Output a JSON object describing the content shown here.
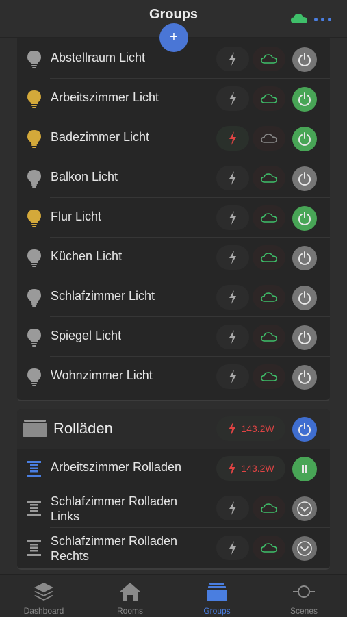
{
  "header": {
    "title": "Groups",
    "add_label": "+"
  },
  "lights": [
    {
      "label": "Abstellraum Licht",
      "on": false,
      "bolt_active": false
    },
    {
      "label": "Arbeitszimmer Licht",
      "on": true,
      "bolt_active": false
    },
    {
      "label": "Badezimmer Licht",
      "on": true,
      "bolt_active": true
    },
    {
      "label": "Balkon Licht",
      "on": false,
      "bolt_active": false
    },
    {
      "label": "Flur Licht",
      "on": true,
      "bolt_active": false
    },
    {
      "label": "Küchen Licht",
      "on": false,
      "bolt_active": false
    },
    {
      "label": "Schlafzimmer Licht",
      "on": false,
      "bolt_active": false
    },
    {
      "label": "Spiegel Licht",
      "on": false,
      "bolt_active": false
    },
    {
      "label": "Wohnzimmer Licht",
      "on": false,
      "bolt_active": false
    }
  ],
  "blinds_group": {
    "title": "Rolläden",
    "power": "143.2W",
    "items": [
      {
        "label": "Arbeitszimmer Rolladen",
        "power": "143.2W"
      },
      {
        "label": "Schlafzimmer Rolladen Links"
      },
      {
        "label": "Schlafzimmer Rolladen Rechts"
      }
    ]
  },
  "tabs": [
    {
      "label": "Dashboard",
      "icon": "layers-icon"
    },
    {
      "label": "Rooms",
      "icon": "house-icon"
    },
    {
      "label": "Groups",
      "icon": "groups-icon",
      "active": true
    },
    {
      "label": "Scenes",
      "icon": "scenes-icon"
    }
  ],
  "colors": {
    "accent": "#4a7ee0",
    "on_green": "#48a556",
    "off_grey": "#767676",
    "bulb_on": "#d4a93a",
    "bulb_off": "#9a9a9a",
    "power_red": "#e04444",
    "cloud_green": "#3fbf6a"
  }
}
